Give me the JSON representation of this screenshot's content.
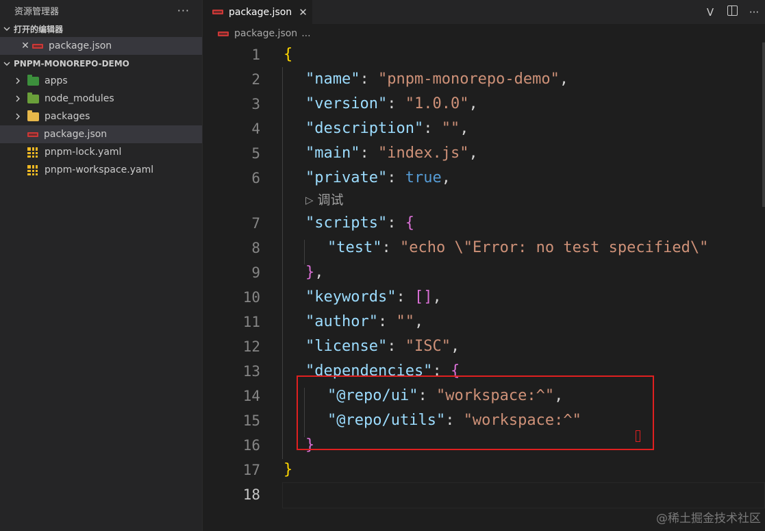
{
  "sidebar": {
    "title": "资源管理器",
    "more": "···",
    "open_editors": {
      "label": "打开的编辑器",
      "items": [
        {
          "close": "✕",
          "name": "package.json"
        }
      ]
    },
    "project": {
      "label": "PNPM-MONOREPO-DEMO",
      "items": [
        {
          "name": "apps",
          "type": "folder"
        },
        {
          "name": "node_modules",
          "type": "folder"
        },
        {
          "name": "packages",
          "type": "folder"
        },
        {
          "name": "package.json",
          "type": "file-npm"
        },
        {
          "name": "pnpm-lock.yaml",
          "type": "file-yaml"
        },
        {
          "name": "pnpm-workspace.yaml",
          "type": "file-yaml"
        }
      ]
    }
  },
  "tab": {
    "label": "package.json",
    "close": "✕"
  },
  "tab_actions": {
    "v_label": "V"
  },
  "breadcrumb": {
    "file": "package.json",
    "rest": "..."
  },
  "editor": {
    "codelens": "调试",
    "lines": [
      "1",
      "2",
      "3",
      "4",
      "5",
      "6",
      "7",
      "8",
      "9",
      "10",
      "11",
      "12",
      "13",
      "14",
      "15",
      "16",
      "17",
      "18"
    ],
    "code": {
      "l1": "{",
      "l2k": "\"name\"",
      "l2v": "\"pnpm-monorepo-demo\"",
      "l3k": "\"version\"",
      "l3v": "\"1.0.0\"",
      "l4k": "\"description\"",
      "l4v": "\"\"",
      "l5k": "\"main\"",
      "l5v": "\"index.js\"",
      "l6k": "\"private\"",
      "l6v": "true",
      "l7k": "\"scripts\"",
      "l7v": "{",
      "l8k": "\"test\"",
      "l8v": "\"echo \\\"Error: no test specified\\\"",
      "l9": "}",
      "l10k": "\"keywords\"",
      "l10v": "[]",
      "l11k": "\"author\"",
      "l11v": "\"\"",
      "l12k": "\"license\"",
      "l12v": "\"ISC\"",
      "l13k": "\"dependencies\"",
      "l13v": "{",
      "l14k": "\"@repo/ui\"",
      "l14v": "\"workspace:^\"",
      "l15k": "\"@repo/utils\"",
      "l15v": "\"workspace:^\"",
      "l16": "}",
      "l17": "}"
    }
  },
  "watermark": "@稀土掘金技术社区",
  "colors": {
    "highlight": "#e02020",
    "key": "#9cdcfe",
    "string": "#ce9178"
  }
}
